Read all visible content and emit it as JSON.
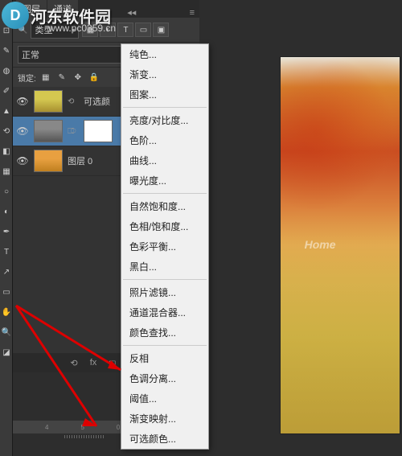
{
  "watermark": {
    "icon": "D",
    "text": "河东软件园",
    "url": "www.pc0359.cn"
  },
  "panel": {
    "tabs": [
      "图层",
      "通道"
    ],
    "filter_label": "类型",
    "blend_mode": "正常",
    "lock_label": "锁定:",
    "layers": [
      {
        "name": "可选颜",
        "thumb": "yellow",
        "visible": true
      },
      {
        "name": "",
        "thumb": "gray",
        "visible": true,
        "selected": true,
        "has_mask": true
      },
      {
        "name": "图层 0",
        "thumb": "orange",
        "visible": true
      }
    ]
  },
  "menu": {
    "groups": [
      [
        "纯色...",
        "渐变...",
        "图案..."
      ],
      [
        "亮度/对比度...",
        "色阶...",
        "曲线...",
        "曝光度..."
      ],
      [
        "自然饱和度...",
        "色相/饱和度...",
        "色彩平衡...",
        "黑白..."
      ],
      [
        "照片滤镜...",
        "通道混合器...",
        "颜色查找..."
      ],
      [
        "反相",
        "色调分离...",
        "阈值...",
        "渐变映射...",
        "可选颜色..."
      ]
    ]
  },
  "image_watermark": "Home",
  "ruler": {
    "marks": [
      "4",
      "5",
      "0"
    ]
  },
  "icons": {
    "link": "⟲",
    "fx": "fx",
    "mask": "◻",
    "adjust": "◐",
    "group": "▣",
    "new": "▤",
    "trash": "🗑",
    "eye": "👁",
    "search": "🔍"
  }
}
